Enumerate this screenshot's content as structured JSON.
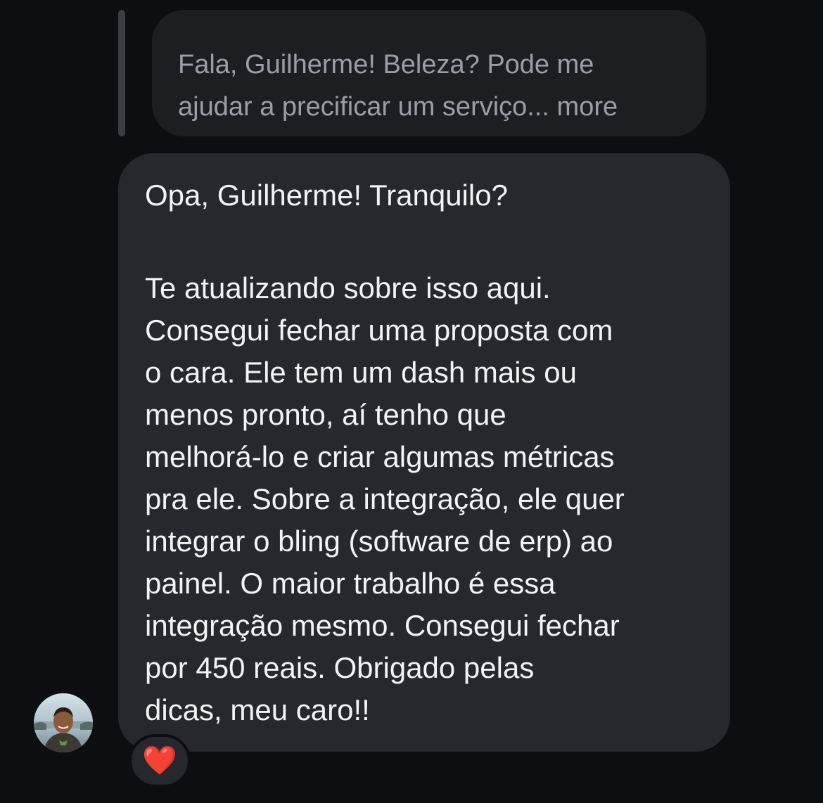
{
  "quoted_message": {
    "text": "Fala, Guilherme! Beleza? Pode me\najudar a precificar um serviço...",
    "more_label": "more"
  },
  "message": {
    "greeting": "Opa, Guilherme! Tranquilo?",
    "lines": [
      "Te atualizando sobre isso aqui.",
      "Consegui fechar uma proposta com",
      "o cara. Ele tem um dash mais ou",
      "menos pronto, aí tenho que",
      "melhorá-lo e criar algumas métricas",
      "pra ele. Sobre a integração, ele quer",
      "integrar o bling (software de erp) ao",
      "painel. O maior trabalho é essa",
      "integração mesmo. Consegui fechar",
      "por 450 reais. Obrigado pelas",
      "dicas, meu caro!!"
    ]
  },
  "reaction": {
    "emoji": "❤️",
    "icon": "red-heart-icon"
  },
  "sender": {
    "avatar": "profile-photo-avatar"
  },
  "colors": {
    "background": "#0c0e12",
    "bubble": "#26282d",
    "quoted_bubble": "#1c1e22",
    "text": "#f2f3f5",
    "quoted_text": "#9a9ea6",
    "heart": "#e21b2d"
  }
}
